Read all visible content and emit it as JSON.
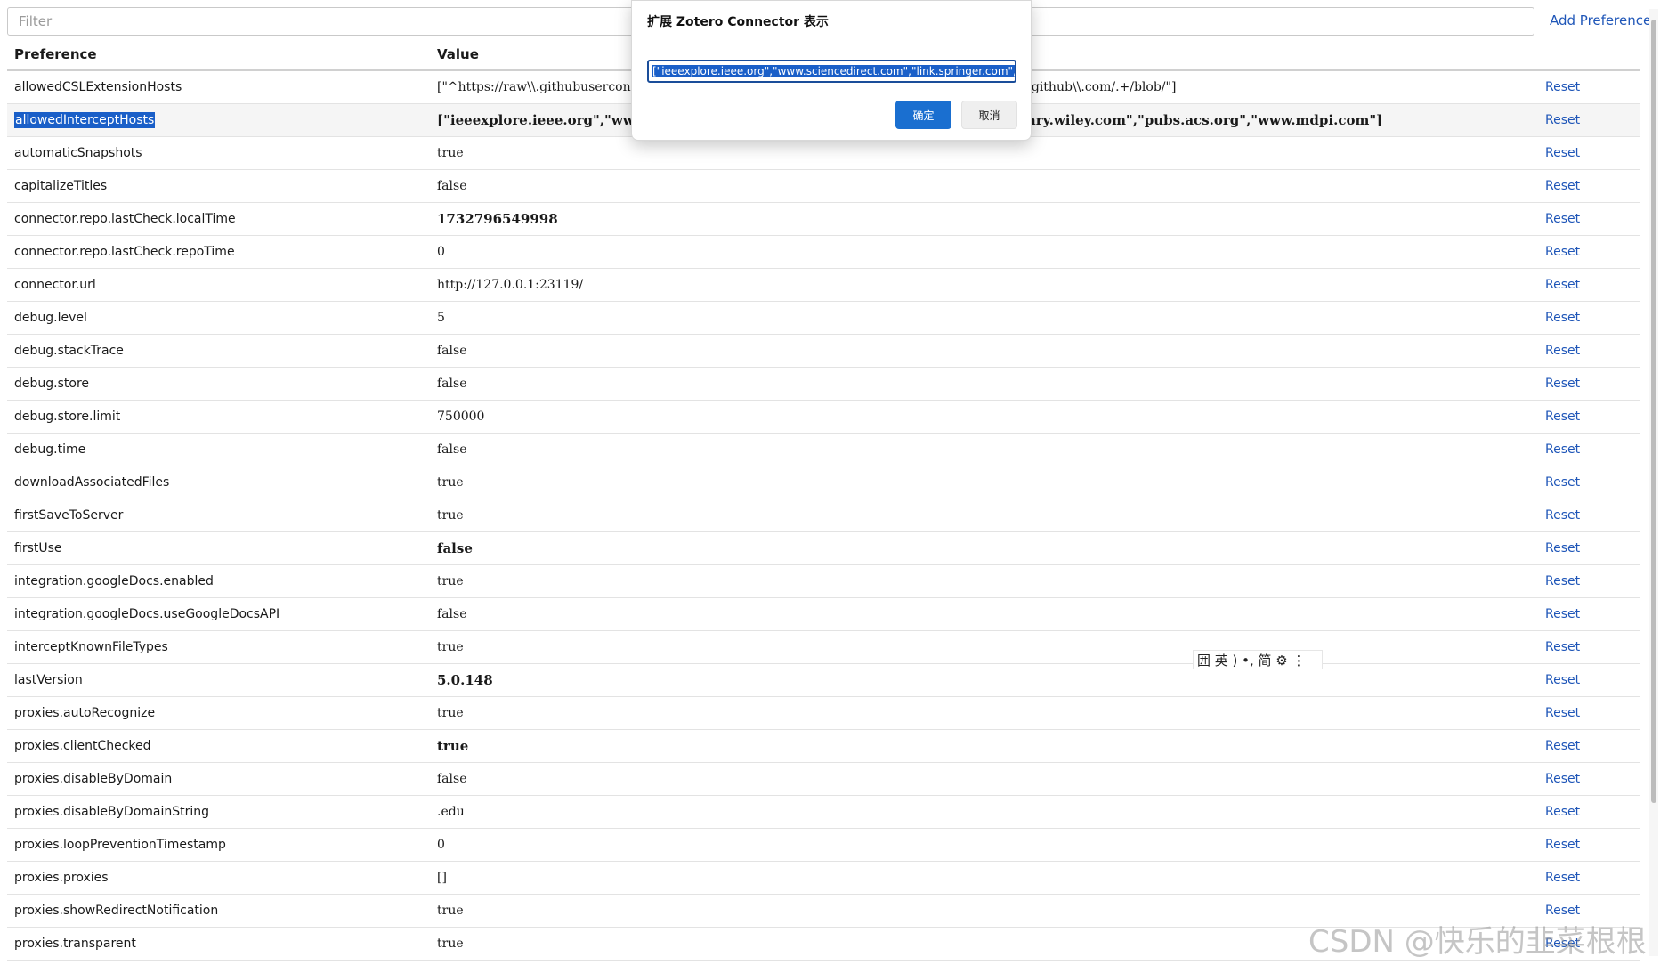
{
  "toolbar": {
    "filter_placeholder": "Filter",
    "filter_value": "",
    "add_preference": "Add Preference"
  },
  "table": {
    "headers": {
      "preference": "Preference",
      "value": "Value",
      "actions": ""
    },
    "rows": [
      {
        "name": "allowedCSLExtensionHosts",
        "value": "[\"^https://raw\\\\.githubusercontent\\\\.com/\", \"^https://gitee\\\\.com/.+/repos/.+/blob/\", \"^https://github\\\\.com/.+/blob/\"]",
        "action": "Reset"
      },
      {
        "name": "allowedInterceptHosts",
        "value": "[\"ieeexplore.ieee.org\",\"www.sciencedirect.com\",\"link.springer.com\",\"onlinelibrary.wiley.com\",\"pubs.acs.org\",\"www.mdpi.com\"]",
        "action": "Reset"
      },
      {
        "name": "automaticSnapshots",
        "value": "true",
        "action": "Reset"
      },
      {
        "name": "capitalizeTitles",
        "value": "false",
        "action": "Reset"
      },
      {
        "name": "connector.repo.lastCheck.localTime",
        "value": "1732796549998",
        "action": "Reset"
      },
      {
        "name": "connector.repo.lastCheck.repoTime",
        "value": "0",
        "action": "Reset"
      },
      {
        "name": "connector.url",
        "value": "http://127.0.0.1:23119/",
        "action": "Reset"
      },
      {
        "name": "debug.level",
        "value": "5",
        "action": "Reset"
      },
      {
        "name": "debug.stackTrace",
        "value": "false",
        "action": "Reset"
      },
      {
        "name": "debug.store",
        "value": "false",
        "action": "Reset"
      },
      {
        "name": "debug.store.limit",
        "value": "750000",
        "action": "Reset"
      },
      {
        "name": "debug.time",
        "value": "false",
        "action": "Reset"
      },
      {
        "name": "downloadAssociatedFiles",
        "value": "true",
        "action": "Reset"
      },
      {
        "name": "firstSaveToServer",
        "value": "true",
        "action": "Reset"
      },
      {
        "name": "firstUse",
        "value": "false",
        "action": "Reset"
      },
      {
        "name": "integration.googleDocs.enabled",
        "value": "true",
        "action": "Reset"
      },
      {
        "name": "integration.googleDocs.useGoogleDocsAPI",
        "value": "false",
        "action": "Reset"
      },
      {
        "name": "interceptKnownFileTypes",
        "value": "true",
        "action": "Reset"
      },
      {
        "name": "lastVersion",
        "value": "5.0.148",
        "action": "Reset"
      },
      {
        "name": "proxies.autoRecognize",
        "value": "true",
        "action": "Reset"
      },
      {
        "name": "proxies.clientChecked",
        "value": "true",
        "action": "Reset"
      },
      {
        "name": "proxies.disableByDomain",
        "value": "false",
        "action": "Reset"
      },
      {
        "name": "proxies.disableByDomainString",
        "value": ".edu",
        "action": "Reset"
      },
      {
        "name": "proxies.loopPreventionTimestamp",
        "value": "0",
        "action": "Reset"
      },
      {
        "name": "proxies.proxies",
        "value": "[]",
        "action": "Reset"
      },
      {
        "name": "proxies.showRedirectNotification",
        "value": "true",
        "action": "Reset"
      },
      {
        "name": "proxies.transparent",
        "value": "true",
        "action": "Reset"
      }
    ]
  },
  "dialog": {
    "title": "扩展 Zotero Connector 表示",
    "input_value": "[\"ieeexplore.ieee.org\",\"www.sciencedirect.com\",\"link.springer.com\",\"onlinelibrary.wiley.com\",\"pubs.acs.org\",\"www.mdpi.com\"]",
    "ok_label": "确定",
    "cancel_label": "取消"
  },
  "ime": {
    "text": "囲 英 ) •, 简 ⚙ ⋮"
  },
  "watermark": "CSDN @快乐的韭菜根根"
}
